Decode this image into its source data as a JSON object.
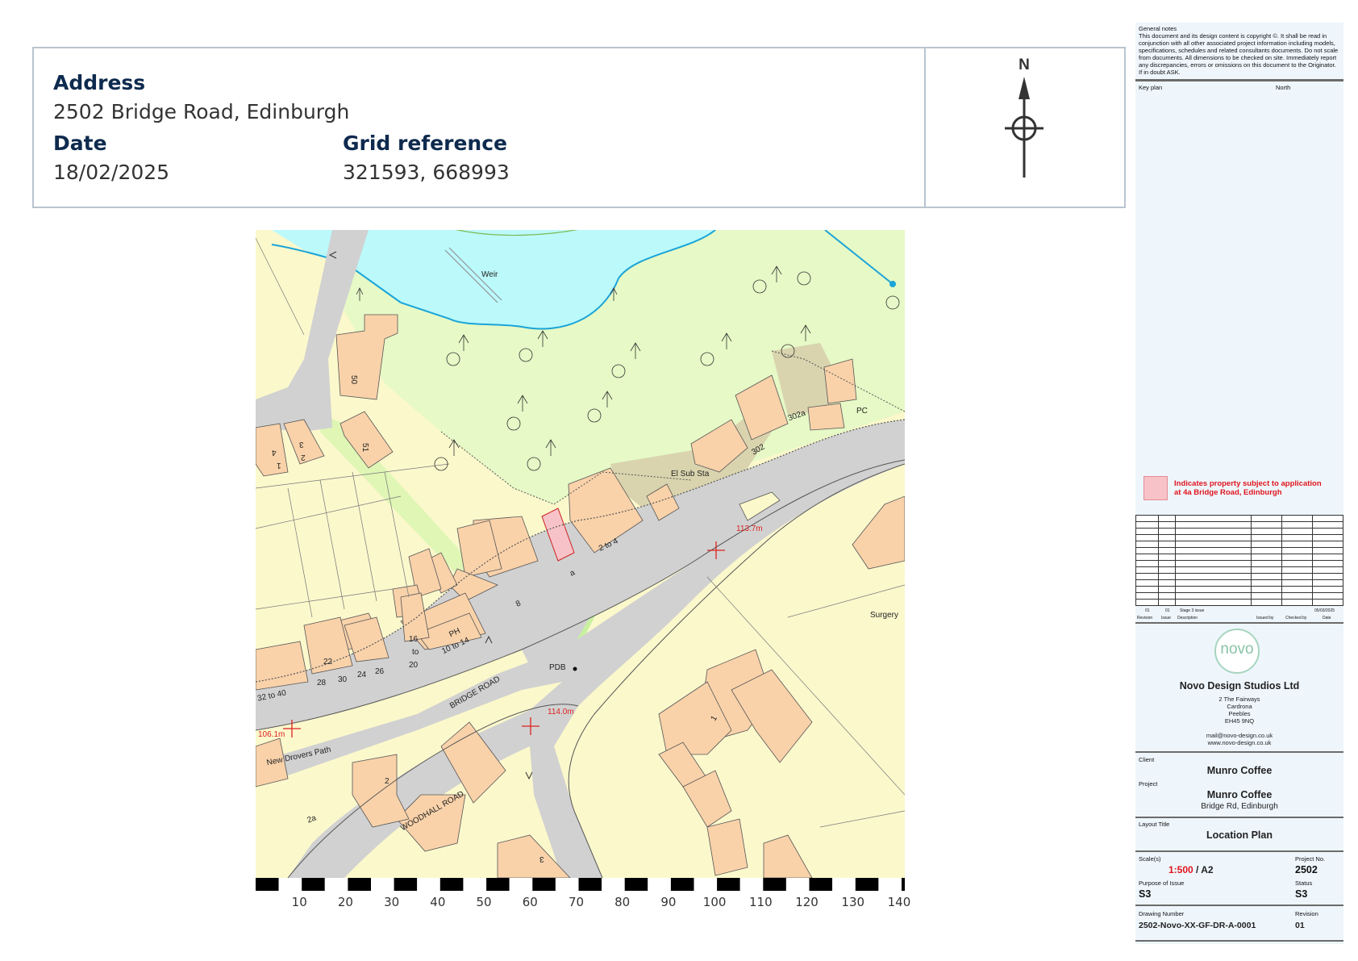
{
  "header": {
    "address_label": "Address",
    "address_value": "2502 Bridge Road, Edinburgh",
    "date_label": "Date",
    "date_value": "18/02/2025",
    "grid_label": "Grid reference",
    "grid_value": "321593, 668993",
    "north_letter": "N"
  },
  "map": {
    "labels": {
      "weir": "Weir",
      "b50": "50",
      "b51": "51",
      "b1": "1",
      "b3": "3",
      "b4": "4",
      "b2": "2",
      "b302a": "302a",
      "pc": "PC",
      "el_sub_sta": "El Sub Sta",
      "b302": "302",
      "b2to4": "2 to 4",
      "a": "a",
      "b8": "8",
      "h113": "113.7m",
      "surgery": "Surgery",
      "ph": "PH",
      "b10to14": "10 to 14",
      "b16": "16",
      "to": "to",
      "b20": "20",
      "b22": "22",
      "b28": "28",
      "b30": "30",
      "b24": "24",
      "b26": "26",
      "b32to40": "32 to 40",
      "bridge_road": "BRIDGE ROAD",
      "pdb": "PDB",
      "h114": "114.0m",
      "h106": "106.1m",
      "new_drovers": "New Drovers Path",
      "b2b": "2",
      "b2a": "2a",
      "woodhall": "WOODHALL ROAD",
      "b1b": "1",
      "b3b": "3"
    },
    "scale_ticks": [
      "10",
      "20",
      "30",
      "40",
      "50",
      "60",
      "70",
      "80",
      "90",
      "100",
      "110",
      "120",
      "130",
      "140"
    ]
  },
  "panel": {
    "general_notes_title": "General notes",
    "general_notes_body": "This document and its design content is copyright ©. It shall be read in conjunction with all other associated project information including models, specifications, schedules and related consultants documents. Do not scale from documents. All dimensions to be checked on site. Immediately report any discrepancies, errors or omissions on this document to the Originator. If in doubt ASK.",
    "key_plan": "Key plan",
    "north": "North",
    "legend_text_1": "Indicates property subject to application",
    "legend_text_2": "at 4a Bridge Road, Edinburgh",
    "legend_color": "#f7c3c8",
    "revision_row": [
      "01",
      "01",
      "Stage 3 issue",
      "",
      "",
      "05/03/2025"
    ],
    "revision_headers": [
      "Revision",
      "Issue",
      "Description",
      "Issued by",
      "Checked by",
      "Date"
    ],
    "logo_text": "novo",
    "company_name": "Novo Design Studios Ltd",
    "company_addr_1": "2 The Fairways",
    "company_addr_2": "Cardrona",
    "company_addr_3": "Peebles",
    "company_addr_4": "EH45 9NQ",
    "company_email": "mail@novo-design.co.uk",
    "company_web": "www.novo-design.co.uk",
    "client_label": "Client",
    "client_value": "Munro Coffee",
    "project_label": "Project",
    "project_value": "Munro Coffee",
    "project_sub": "Bridge Rd, Edinburgh",
    "layout_title_label": "Layout Title",
    "layout_title_value": "Location Plan",
    "scale_label": "Scale(s)",
    "scale_value_red": "1:500",
    "scale_value_rest": " / A2",
    "project_no_label": "Project No.",
    "project_no_value": "2502",
    "purpose_label": "Purpose of Issue",
    "purpose_value": "S3",
    "status_label": "Status",
    "status_value": "S3",
    "drawing_number_label": "Drawing Number",
    "drawing_number_value": "2502-Novo-XX-GF-DR-A-0001",
    "revision_label": "Revision",
    "revision_value": "01"
  }
}
